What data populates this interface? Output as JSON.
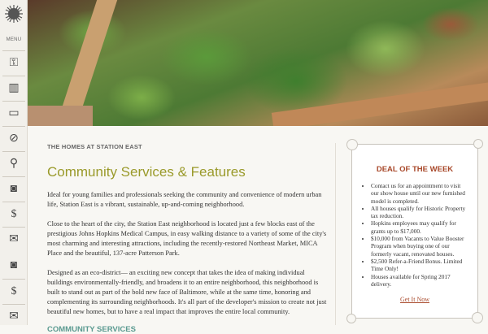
{
  "sidebar": {
    "menu_label": "MENU",
    "items": [
      "key-icon",
      "building-icon",
      "sign-icon",
      "compass-icon",
      "bicycle-icon",
      "camera-icon",
      "money-bag-icon",
      "envelope-icon",
      "camera-icon",
      "money-bag-icon",
      "envelope-icon"
    ]
  },
  "content": {
    "eyebrow": "THE HOMES AT STATION EAST",
    "title": "Community Services & Features",
    "paragraphs": [
      "Ideal for young families and professionals seeking the community and convenience of modern urban life, Station East is a vibrant, sustainable, up-and-coming neighborhood.",
      "Close to the heart of the city, the Station East neighborhood is located just a few blocks east of the prestigious Johns Hopkins Medical Campus, in easy walking distance to a variety of some of the city's most charming and interesting attractions, including the recently-restored Northeast Market, MICA Place and the beautiful, 137-acre Patterson Park.",
      "Designed as an eco-district— an exciting new concept that takes the idea of making individual buildings environmentally-friendly, and broadens it to an entire neighborhood, this neighborhood is built to stand out as part of the bold new face of Baltimore, while at the same time, honoring and complementing its surrounding neighborhoods. It's all part of the developer's mission to create not just beautiful new homes, but to have a real impact that improves the entire local community."
    ],
    "section_heading": "COMMUNITY SERVICES"
  },
  "deal": {
    "title": "DEAL OF THE WEEK",
    "items": [
      "Contact us for an appointment to visit our show house until our new furnished model is completed.",
      "All houses qualify for Historic Property tax reduction.",
      "Hopkins employees may qualify for grants up to $17,000.",
      "$10,000 from Vacants to Value Booster Program when buying one of our formerly vacant, renovated houses.",
      "$2,500 Refer-a-Friend Bonus. Limited Time Only!",
      "Houses available for Spring 2017 delivery."
    ],
    "cta": "Get It Now"
  },
  "colors": {
    "title": "#9a9a2a",
    "deal_accent": "#a8482a",
    "section": "#5a9a90"
  }
}
